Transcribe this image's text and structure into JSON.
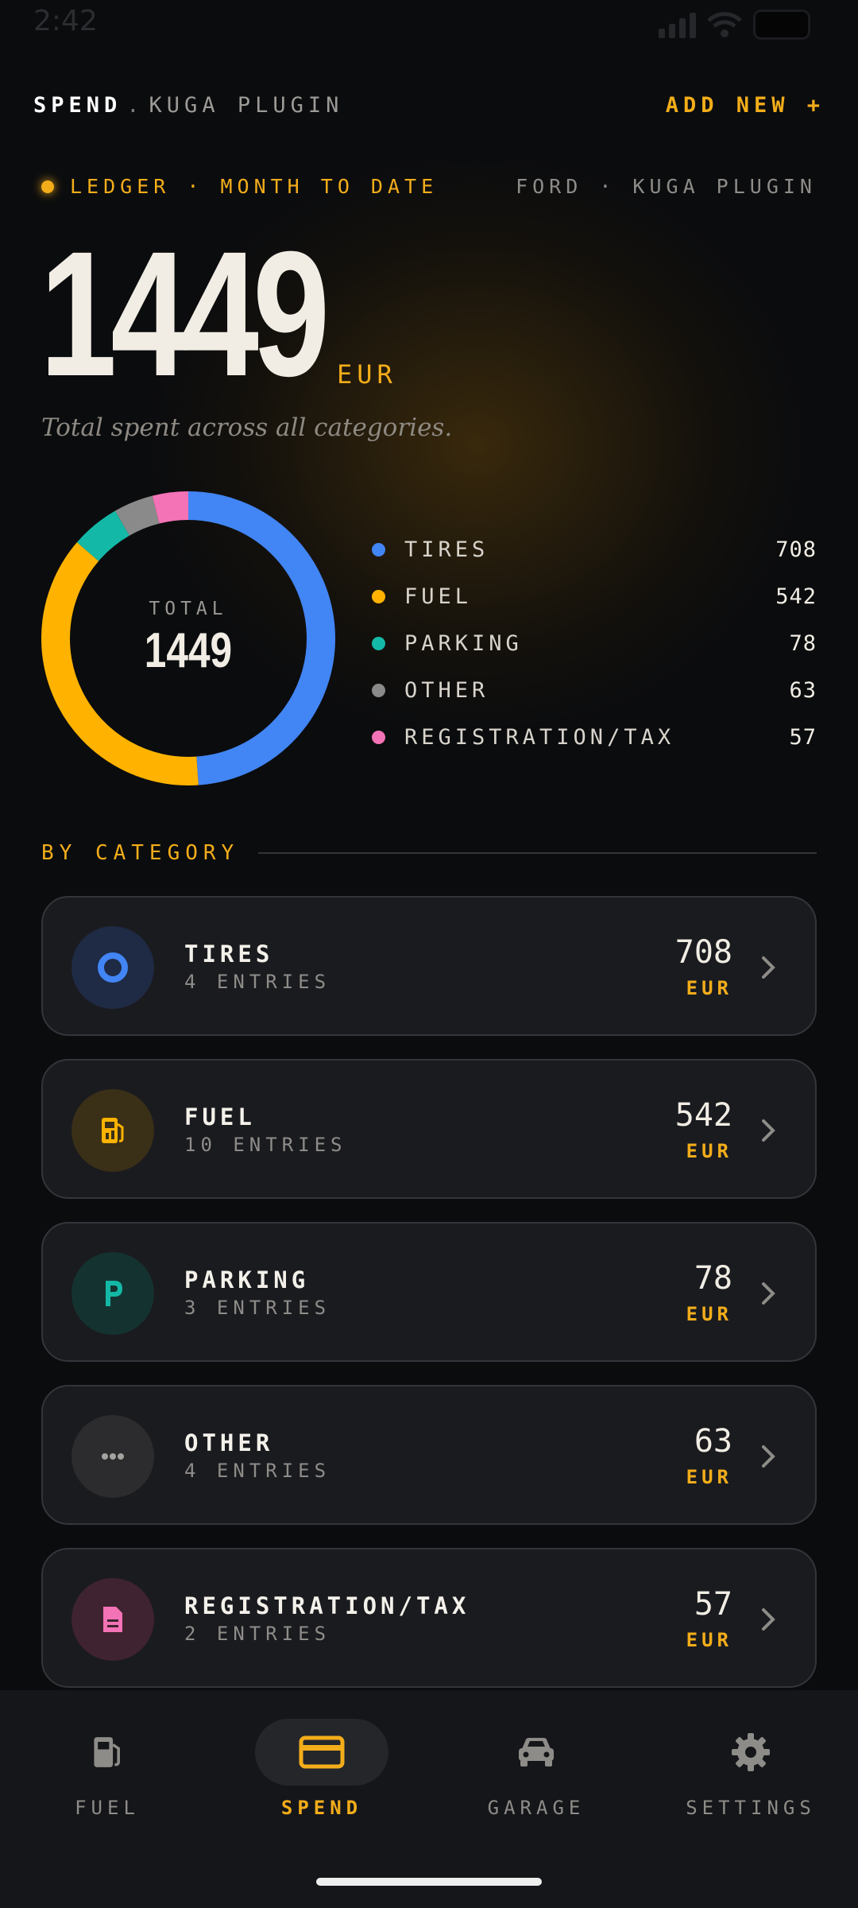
{
  "status": {
    "time": "2:42"
  },
  "header": {
    "title": "SPEND",
    "separator": ".",
    "subtitle": "KUGA PLUGIN",
    "action": "ADD NEW +"
  },
  "ledger": {
    "label": "LEDGER · MONTH TO DATE",
    "vehicle": "FORD · KUGA PLUGIN"
  },
  "total": {
    "value": "1449",
    "currency": "EUR",
    "caption": "Total spent across all categories."
  },
  "donut": {
    "center_label": "TOTAL",
    "center_value": "1449"
  },
  "chart_data": {
    "type": "pie",
    "categories": [
      "TIRES",
      "FUEL",
      "PARKING",
      "OTHER",
      "REGISTRATION/TAX"
    ],
    "values": [
      708,
      542,
      78,
      63,
      57
    ],
    "colors": [
      "#4285f4",
      "#ffb300",
      "#14b8a6",
      "#8a8a8a",
      "#f472b6"
    ]
  },
  "legend": [
    {
      "name": "TIRES",
      "value": "708",
      "color": "#4285f4"
    },
    {
      "name": "FUEL",
      "value": "542",
      "color": "#ffb300"
    },
    {
      "name": "PARKING",
      "value": "78",
      "color": "#14b8a6"
    },
    {
      "name": "OTHER",
      "value": "63",
      "color": "#8a8a8a"
    },
    {
      "name": "REGISTRATION/TAX",
      "value": "57",
      "color": "#f472b6"
    }
  ],
  "section": {
    "title": "BY CATEGORY"
  },
  "categories": [
    {
      "name": "TIRES",
      "entries": "4 ENTRIES",
      "amount": "708",
      "currency": "EUR",
      "icon": "tire-icon"
    },
    {
      "name": "FUEL",
      "entries": "10 ENTRIES",
      "amount": "542",
      "currency": "EUR",
      "icon": "fuel-pump-icon"
    },
    {
      "name": "PARKING",
      "entries": "3 ENTRIES",
      "amount": "78",
      "currency": "EUR",
      "icon": "parking-icon"
    },
    {
      "name": "OTHER",
      "entries": "4 ENTRIES",
      "amount": "63",
      "currency": "EUR",
      "icon": "more-dots-icon"
    },
    {
      "name": "REGISTRATION/TAX",
      "entries": "2 ENTRIES",
      "amount": "57",
      "currency": "EUR",
      "icon": "document-icon"
    }
  ],
  "nav": [
    {
      "label": "FUEL",
      "icon": "fuel-pump-icon",
      "active": false
    },
    {
      "label": "SPEND",
      "icon": "credit-card-icon",
      "active": true
    },
    {
      "label": "GARAGE",
      "icon": "car-icon",
      "active": false
    },
    {
      "label": "SETTINGS",
      "icon": "gear-icon",
      "active": false
    }
  ],
  "colors": {
    "accent": "#f3ad1a",
    "background": "#0b0c0e",
    "card": "#1a1b1f"
  }
}
